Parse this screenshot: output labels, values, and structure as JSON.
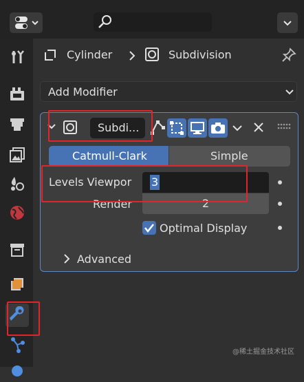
{
  "breadcrumb": {
    "object": "Cylinder",
    "modifier": "Subdivision"
  },
  "add_modifier_label": "Add Modifier",
  "modifier": {
    "name": "Subdi...",
    "subdivision_types": [
      "Catmull-Clark",
      "Simple"
    ],
    "selected_type": "Catmull-Clark",
    "levels_viewport_label": "Levels Viewpor",
    "levels_viewport_value": "3",
    "render_label": "Render",
    "render_value": "2",
    "optimal_display_label": "Optimal Display",
    "optimal_display_checked": true,
    "advanced_label": "Advanced"
  },
  "watermark": "@稀土掘金技术社区",
  "colors": {
    "accent": "#4772b3",
    "highlight": "#e0252c",
    "panel_border": "#5e87c4"
  }
}
